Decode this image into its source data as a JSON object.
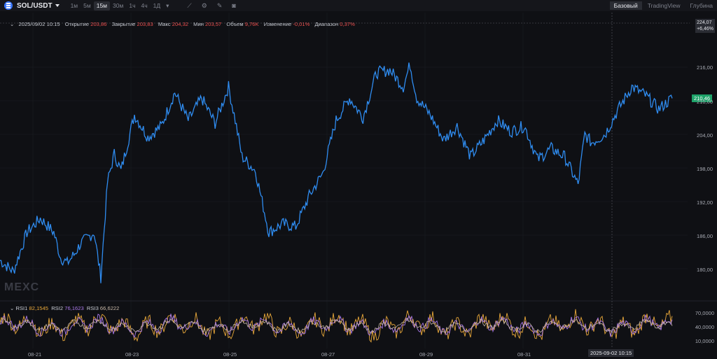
{
  "header": {
    "symbol": "SOL/USDT",
    "timeframes": [
      "1м",
      "5м",
      "15м",
      "30м",
      "1ч",
      "4ч",
      "1Д"
    ],
    "active_timeframe": "15м",
    "views": [
      "Базовый",
      "TradingView",
      "Глубина"
    ],
    "active_view": "Базовый"
  },
  "ohlc": {
    "date": "2025/09/02 10:15",
    "open_label": "Открытие",
    "open": "203,86",
    "close_label": "Закрытие",
    "close": "203,83",
    "high_label": "Макс",
    "high": "204,32",
    "low_label": "Мин",
    "low": "203,57",
    "volume_label": "Объем",
    "volume": "9,76K",
    "change_label": "Изменение",
    "change": "-0,01%",
    "range_label": "Диапазон",
    "range": "0,37%"
  },
  "price_tag": {
    "price": "224,07",
    "pct": "+6,46%"
  },
  "last_price": "210,46",
  "watermark": "MEXC",
  "rsi": {
    "rsi1_label": "RSI1",
    "rsi1": "82,1545",
    "rsi2_label": "RSI2",
    "rsi2": "76,1623",
    "rsi3_label": "RSI3",
    "rsi3": "66,6222",
    "ticks": [
      "70,0000",
      "40,0000",
      "10,0000"
    ]
  },
  "crosshair_date": "2025-09-02 10:15",
  "colors": {
    "line": "#2f8cf0",
    "rsi1": "#e9a83a",
    "rsi2": "#a979e8",
    "rsi3": "#c7b7a7",
    "up": "#1fa36a",
    "down": "#f0504f"
  },
  "chart_data": {
    "type": "line",
    "y_ticks": [
      "216,00",
      "210,00",
      "204,00",
      "198,00",
      "192,00",
      "186,00",
      "180,00"
    ],
    "x_ticks": [
      "08-21",
      "08-23",
      "08-25",
      "08-27",
      "08-29",
      "08-31"
    ],
    "ylim": [
      176,
      224
    ],
    "series": [
      {
        "x": [
          0,
          0.02,
          0.04,
          0.06,
          0.08,
          0.09,
          0.1,
          0.11,
          0.12,
          0.14,
          0.15,
          0.16,
          0.17,
          0.18,
          0.2,
          0.22,
          0.24,
          0.26,
          0.28,
          0.3,
          0.32,
          0.34,
          0.35,
          0.36,
          0.38,
          0.4,
          0.42,
          0.44,
          0.46,
          0.48,
          0.5,
          0.52,
          0.54,
          0.56,
          0.58,
          0.6,
          0.61,
          0.62,
          0.64,
          0.66,
          0.68,
          0.7,
          0.72,
          0.74,
          0.76,
          0.78,
          0.8,
          0.82,
          0.84,
          0.86,
          0.87,
          0.88,
          0.9,
          0.92,
          0.94,
          0.96,
          0.98,
          1.0
        ],
        "values": [
          181.5,
          179.5,
          186.5,
          189,
          186.5,
          182,
          181,
          182.5,
          184.5,
          186.5,
          178.5,
          195.5,
          200.5,
          197.5,
          207.5,
          203.5,
          205.5,
          211.5,
          206.5,
          210.5,
          206,
          212.5,
          206.5,
          200,
          197.5,
          186.5,
          188,
          187.5,
          193,
          197,
          206.5,
          210.5,
          207,
          215,
          215.5,
          212.5,
          216.5,
          210.5,
          207.5,
          203,
          205.5,
          200,
          203,
          206.5,
          204.5,
          205.5,
          199.5,
          201.5,
          200,
          195,
          204,
          202.5,
          204,
          208.5,
          212.5,
          211,
          208.5,
          210.5
        ]
      }
    ]
  }
}
